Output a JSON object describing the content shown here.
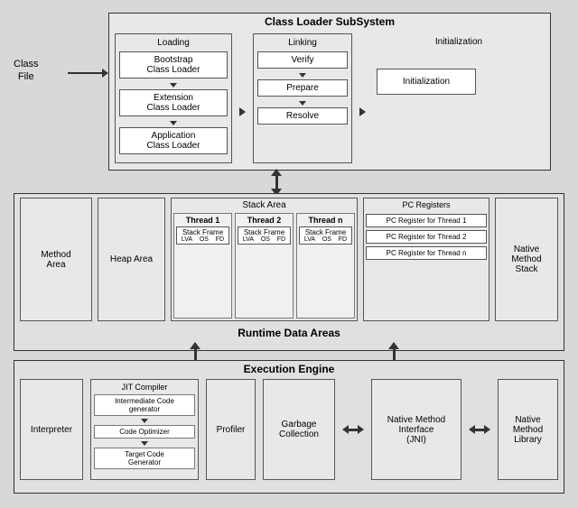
{
  "classLoader": {
    "title": "Class Loader SubSystem",
    "loading": {
      "sectionLabel": "Loading",
      "boxes": [
        "Bootstrap\nClass Loader",
        "Extension\nClass Loader",
        "Application\nClass Loader"
      ]
    },
    "linking": {
      "sectionLabel": "Linking",
      "boxes": [
        "Verify",
        "Prepare",
        "Resolve"
      ]
    },
    "initialization": {
      "sectionLabel": "Initialization",
      "box": "Initialization"
    }
  },
  "classFile": {
    "line1": "Class",
    "line2": "File"
  },
  "runtimeDataAreas": {
    "title": "Runtime Data Areas",
    "methodArea": "Method\nArea",
    "heapArea": "Heap Area",
    "stackArea": {
      "label": "Stack Area",
      "threads": [
        {
          "label": "Thread 1",
          "frameLabel": "Stack Frame",
          "subLabels": [
            "LVA",
            "OS",
            "FD"
          ]
        },
        {
          "label": "Thread 2",
          "frameLabel": "Stack Frame",
          "subLabels": [
            "LVA",
            "OS",
            "FD"
          ]
        },
        {
          "label": "Thread n",
          "frameLabel": "Stack Frame",
          "subLabels": [
            "LVA",
            "OS",
            "FD"
          ]
        }
      ]
    },
    "pcRegisters": {
      "label": "PC Registers",
      "items": [
        "PC Register for Thread 1",
        "PC Register for Thread 2",
        "PC Register for Thread n"
      ]
    },
    "nativeMethodStack": "Native\nMethod\nStack"
  },
  "executionEngine": {
    "title": "Execution Engine",
    "interpreter": "Interpreter",
    "jitCompiler": {
      "label": "JIT Compiler",
      "boxes": [
        "Intermediate Code\ngenerator",
        "Code Optimizer",
        "Target Code\nGenerator"
      ]
    },
    "profiler": "Profiler",
    "garbageCollection": "Garbage\nCollection",
    "jni": "Native Method\nInterface\n(JNI)",
    "nativeMethodLibrary": "Native Method\nLibrary"
  }
}
